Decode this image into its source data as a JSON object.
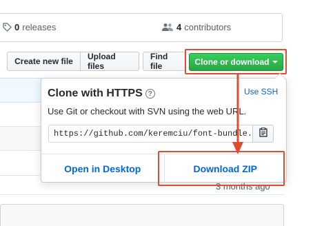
{
  "summary": {
    "releases_count": "0",
    "releases_label": "releases",
    "contributors_count": "4",
    "contributors_label": "contributors"
  },
  "toolbar": {
    "create_new_file": "Create new file",
    "upload_files": "Upload files",
    "find_file": "Find file",
    "clone_or_download": "Clone or download"
  },
  "file_list": {
    "last_row_time": "3 months ago"
  },
  "clone_popover": {
    "title": "Clone with HTTPS",
    "help_symbol": "?",
    "use_ssh": "Use SSH",
    "description": "Use Git or checkout with SVN using the web URL.",
    "url_value": "https://github.com/keremciu/font-bundle.git",
    "open_in_desktop": "Open in Desktop",
    "download_zip": "Download ZIP"
  },
  "colors": {
    "clone_button": "#28a745",
    "link": "#0366d6",
    "annotation": "#e04c2f"
  },
  "icons": {
    "releases": "tag-icon",
    "contributors": "people-icon",
    "help": "question-icon",
    "copy": "clipboard-icon"
  }
}
